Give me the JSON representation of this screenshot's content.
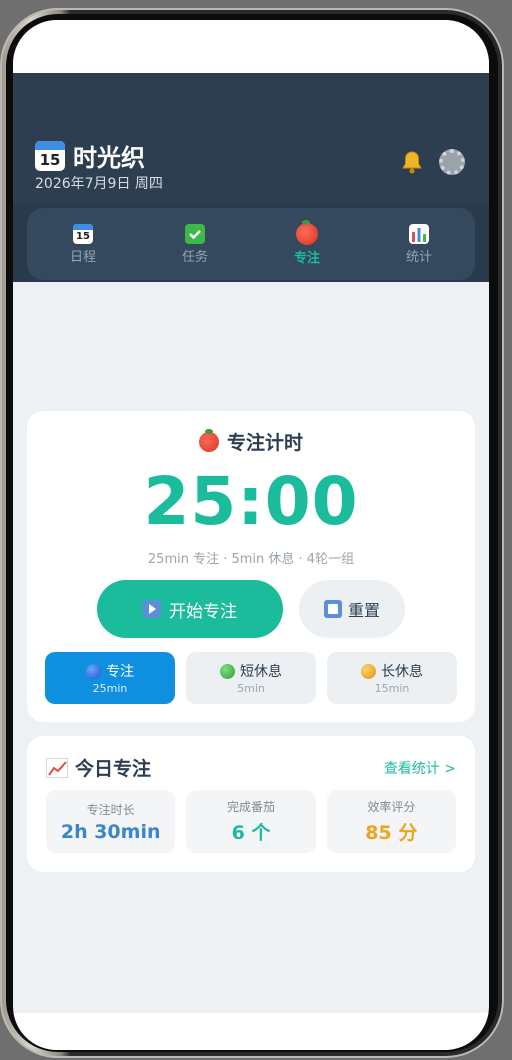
{
  "app": {
    "title": "时光织",
    "date": "2026年7月9日 周四",
    "calendar_icon_day": "15"
  },
  "nav": {
    "tabs": [
      {
        "label": "日程",
        "icon": "calendar-icon"
      },
      {
        "label": "任务",
        "icon": "checkbox-icon"
      },
      {
        "label": "专注",
        "icon": "tomato-icon",
        "active": true
      },
      {
        "label": "统计",
        "icon": "bar-chart-icon"
      }
    ]
  },
  "timer_card": {
    "title": "专注计时",
    "time": "25:00",
    "subtitle": "25min 专注 · 5min 休息 · 4轮一组",
    "start_label": "开始专注",
    "reset_label": "重置",
    "modes": [
      {
        "label": "专注",
        "sub": "25min",
        "color": "#2a6fe0"
      },
      {
        "label": "短休息",
        "sub": "5min",
        "color": "#3db94a"
      },
      {
        "label": "长休息",
        "sub": "15min",
        "color": "#f0a31e"
      }
    ]
  },
  "today_card": {
    "title": "今日专注",
    "link": "查看统计 >",
    "stats": [
      {
        "label": "专注时长",
        "value": "2h 30min",
        "color": "#3a86c8"
      },
      {
        "label": "完成番茄",
        "value": "6 个",
        "color": "#1abc9c"
      },
      {
        "label": "效率评分",
        "value": "85 分",
        "color": "#f0a31e"
      }
    ]
  },
  "colors": {
    "header_bg": "#2c3e50",
    "accent": "#1abc9c",
    "active_mode": "#0e8fe0"
  }
}
